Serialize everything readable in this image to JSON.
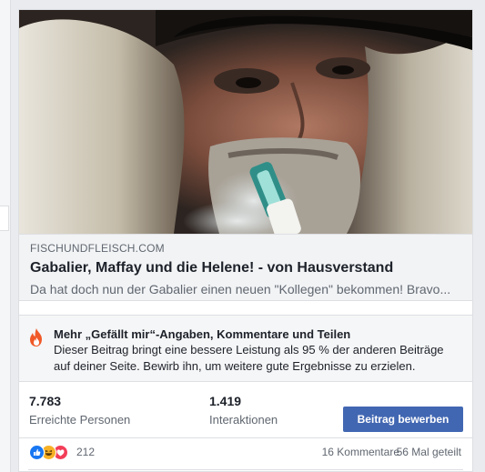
{
  "link_preview": {
    "domain": "FISCHUNDFLEISCH.COM",
    "title": "Gabalier, Maffay und die Helene! - von Hausverstand",
    "description": "Da hat doch nun der Gabalier einen neuen \"Kollegen\" bekommen! Bravo..."
  },
  "boost_tip": {
    "icon": "fire-icon",
    "title": "Mehr „Gefällt mir“-Angaben, Kommentare und Teilen",
    "text_line1": "Dieser Beitrag bringt eine bessere Leistung als 95 % der anderen Beiträge",
    "text_line2": "auf deiner Seite. Bewirb ihn, um weitere gute Ergebnisse zu erzielen."
  },
  "stats": {
    "reach_value": "7.783",
    "reach_label": "Erreichte Personen",
    "engagement_value": "1.419",
    "engagement_label": "Interaktionen",
    "boost_button_label": "Beitrag bewerben"
  },
  "reactions": {
    "icons": [
      "like-icon",
      "haha-icon",
      "love-icon"
    ],
    "count": "212",
    "comments": "16 Kommentare",
    "shares": "56 Mal geteilt"
  },
  "colors": {
    "accent": "#4267b2",
    "like": "#1877f2",
    "haha": "#f7b125",
    "love": "#f33e58",
    "fire": "#f05a28"
  }
}
